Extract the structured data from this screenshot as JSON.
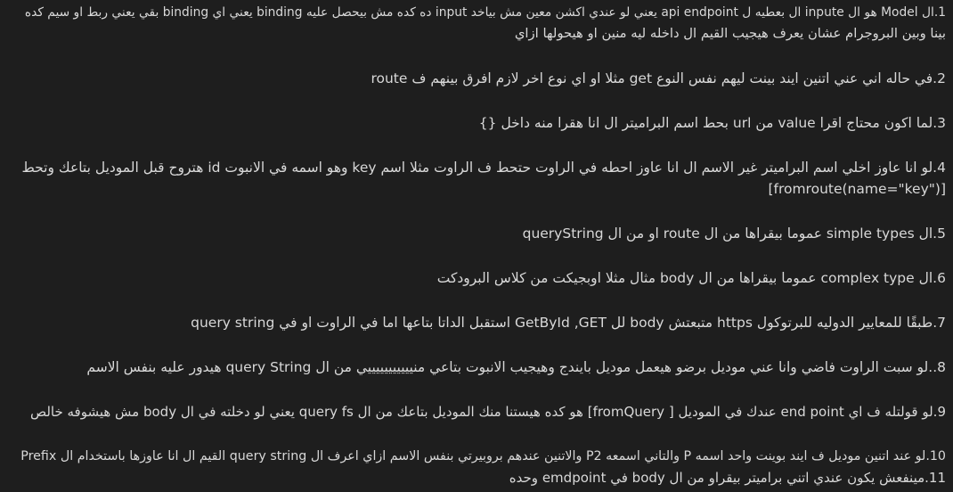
{
  "paragraphs": [
    {
      "id": "p1",
      "lines": [
        "1.ال Model هو ال inpute ال بعطيه ل api endpoint يعني لو عندي اكشن معين مش بياخد input ده كده مش بيحصل عليه binding يعني اي binding بقي يعني ربط او سيم كده",
        "بينا وبين البروجرام عشان يعرف هيجيب القيم ال داخله ليه منين او هيحولها ازاي"
      ]
    },
    {
      "id": "p2",
      "lines": [
        "2.في حاله اني عني اتنين ايند بينت ليهم نفس النوع get مثلا او اي نوع اخر لازم افرق بينهم ف route"
      ]
    },
    {
      "id": "p3",
      "lines": [
        "3.لما اكون محتاج اقرا value من url بحط اسم البراميتر ال انا هقرا منه داخل  {}"
      ]
    },
    {
      "id": "p4",
      "lines": [
        "4.لو انا عاوز اخلي اسم البراميتر غير الاسم ال انا عاوز احطه في الراوت حتحط ف الراوت مثلا اسم key وهو اسمه في الانبوت id هتروح قبل الموديل بتاعك وتحط",
        "[fromroute(name=\"key\")]"
      ]
    },
    {
      "id": "p5",
      "lines": [
        "5.ال simple types عموما بيقراها من ال route او من ال queryString"
      ]
    },
    {
      "id": "p6",
      "lines": [
        "6.ال complex type عموما بيقراها من ال body مثال مثلا اوبجيكت من كلاس البرودكت"
      ]
    },
    {
      "id": "p7",
      "lines": [
        "7.طبقًا للمعايير الدوليه للبرتوكول https  متبعتش   body   لل   GetById ,GET  استقبل الداتا بتاعها اما في الراوت او في query string"
      ]
    },
    {
      "id": "p8",
      "lines": [
        "8..لو سبت الراوت فاضي وانا عني موديل برضو هيعمل موديل بايندج وهيجيب الانبوت بتاعي منيييييييييييي    من ال query String هيدور عليه بنفس الاسم"
      ]
    },
    {
      "id": "p9",
      "lines": [
        "9.لو قولتله ف اي end point عندك في الموديل [ fromQuery] هو كده هيستنا منك الموديل بتاعك من ال query fs يعني لو دخلته في ال body مش هيشوفه خالص"
      ]
    },
    {
      "id": "p10",
      "lines": [
        "10.لو عند  اتنين موديل ف ايند بوينت واحد اسمه P والتاني اسمعه P2 والاتنين عندهم بروبيرتي بنفس الاسم ازاي اعرف ال query string القيم ال انا عاوزها باستخدام ال Prefix",
        "11.مينفعش يكون عندي اتني براميتر بيقراو من ال body في emdpoint وحده"
      ]
    }
  ]
}
